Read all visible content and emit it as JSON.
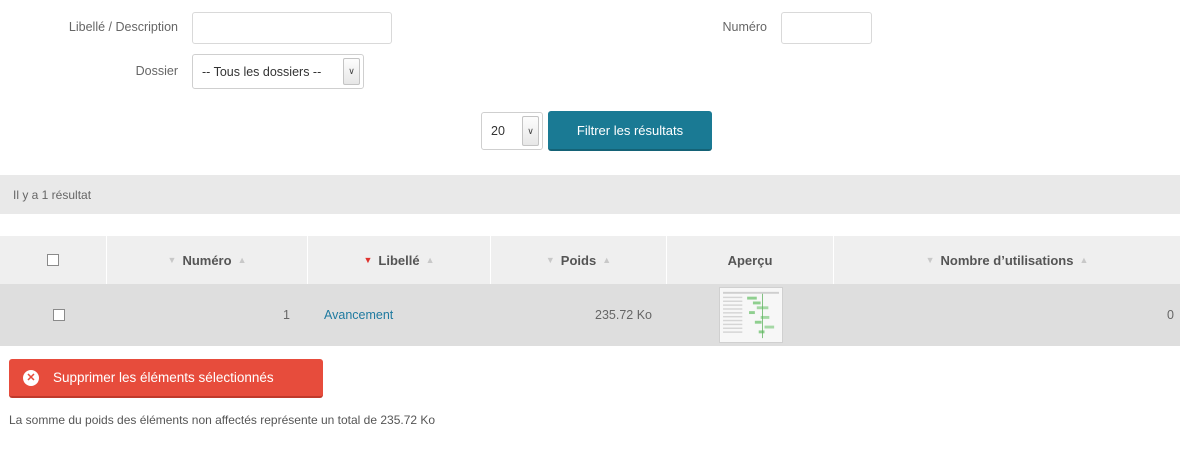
{
  "filters": {
    "libelle_label": "Libellé / Description",
    "libelle_value": "",
    "numero_label": "Numéro",
    "numero_value": "",
    "dossier_label": "Dossier",
    "dossier_selected": "-- Tous les dossiers --",
    "per_page_selected": "20",
    "filter_button": "Filtrer les résultats"
  },
  "results_count": "Il y a 1 résultat",
  "table": {
    "columns": [
      {
        "label": "Numéro",
        "sortable": true,
        "active": false
      },
      {
        "label": "Libellé",
        "sortable": true,
        "active": true
      },
      {
        "label": "Poids",
        "sortable": true,
        "active": false
      },
      {
        "label": "Aperçu",
        "sortable": false,
        "active": false
      },
      {
        "label": "Nombre d’utilisations",
        "sortable": true,
        "active": false
      }
    ],
    "rows": [
      {
        "numero": "1",
        "libelle": "Avancement",
        "poids": "235.72 Ko",
        "apercu": "thumbnail",
        "utilisations": "0"
      }
    ]
  },
  "delete_button": "Supprimer les éléments sélectionnés",
  "footer_note": "La somme du poids des éléments non affectés représente un total de 235.72 Ko",
  "colors": {
    "primary": "#1a7a94",
    "danger": "#e74c3c",
    "link": "#1f7aa0",
    "sort_active": "#e0332e"
  },
  "icons": {
    "select_arrow": "chevron-down-icon",
    "sort_desc": "caret-down-icon",
    "sort_asc": "caret-up-icon",
    "delete": "times-circle-icon"
  }
}
